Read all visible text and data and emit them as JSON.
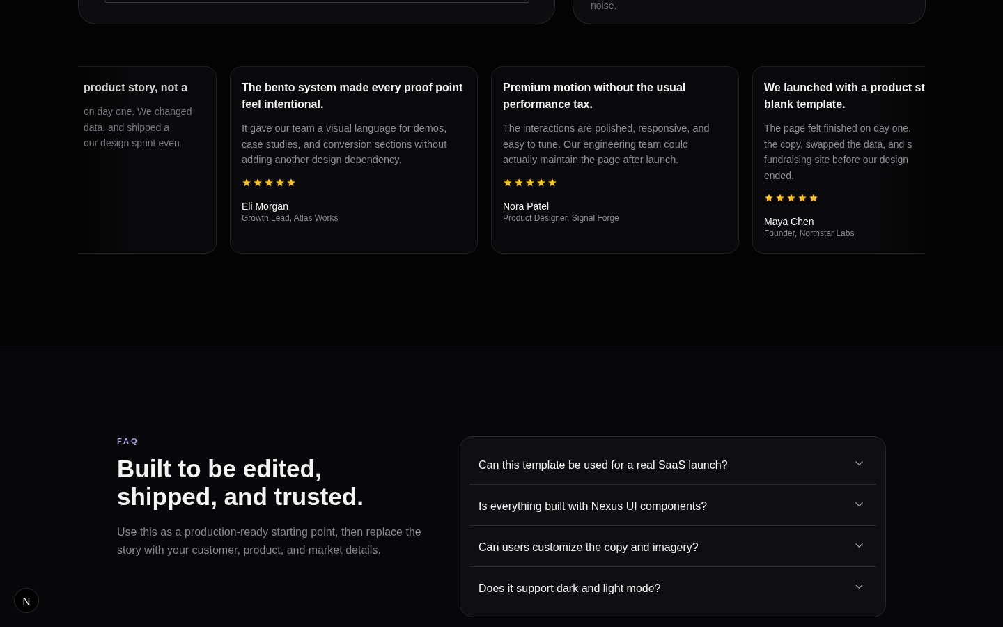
{
  "top_cards": {
    "right_card_text": "noise."
  },
  "testimonials": [
    {
      "kind": "cut_left",
      "title_lines": [
        "product story, not a"
      ],
      "body_lines": [
        "on day one. We changed",
        "data, and shipped a",
        "our design sprint even"
      ]
    },
    {
      "kind": "full",
      "title": "The bento system made every proof point feel intentional.",
      "body": "It gave our team a visual language for demos, case studies, and conversion sections without adding another design dependency.",
      "stars": 5,
      "name": "Eli Morgan",
      "role": "Growth Lead, Atlas Works"
    },
    {
      "kind": "full",
      "title": "Premium motion without the usual performance tax.",
      "body": "The interactions are polished, responsive, and easy to tune. Our engineering team could actually maintain the page after launch.",
      "stars": 5,
      "name": "Nora Patel",
      "role": "Product Designer, Signal Forge"
    },
    {
      "kind": "cut_right",
      "title_lines": [
        "We launched with a product st",
        "blank template."
      ],
      "body_lines": [
        "The page felt finished on day one.",
        "the copy, swapped the data, and s",
        "fundraising site before our design",
        "ended."
      ],
      "stars": 5,
      "name": "Maya Chen",
      "role": "Founder, Northstar Labs"
    }
  ],
  "faq": {
    "eyebrow": "FAQ",
    "heading_lines": [
      "Built to be edited,",
      "shipped, and trusted."
    ],
    "description": "Use this as a production-ready starting point, then replace the story with your customer, product, and market details.",
    "items": [
      {
        "question": "Can this template be used for a real SaaS launch?",
        "expanded": false
      },
      {
        "question": "Is everything built with Nexus UI components?",
        "expanded": false
      },
      {
        "question": "Can users customize the copy and imagery?",
        "expanded": false
      },
      {
        "question": "Does it support dark and light mode?",
        "expanded": false
      }
    ]
  },
  "floating_badge": {
    "letter": "N"
  }
}
